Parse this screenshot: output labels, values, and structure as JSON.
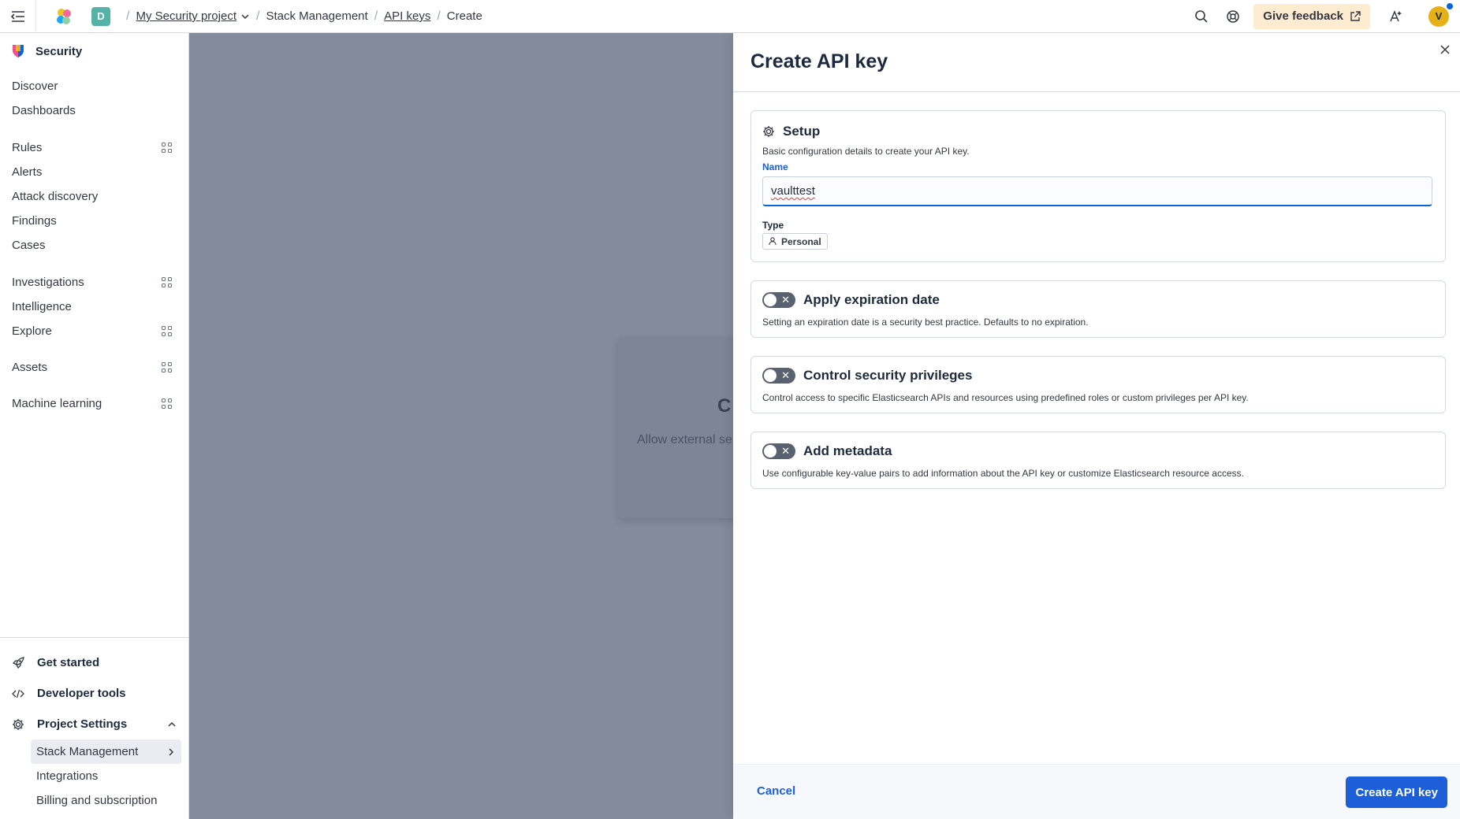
{
  "header": {
    "space_initial": "D",
    "breadcrumbs": [
      "My Security project",
      "Stack Management",
      "API keys",
      "Create"
    ],
    "feedback_label": "Give feedback",
    "avatar_initial": "V"
  },
  "sidebar": {
    "title": "Security",
    "groups": [
      [
        {
          "label": "Discover"
        },
        {
          "label": "Dashboards"
        }
      ],
      [
        {
          "label": "Rules"
        },
        {
          "label": "Alerts"
        },
        {
          "label": "Attack discovery"
        },
        {
          "label": "Findings"
        },
        {
          "label": "Cases"
        }
      ],
      [
        {
          "label": "Investigations"
        },
        {
          "label": "Intelligence"
        },
        {
          "label": "Explore"
        }
      ],
      [
        {
          "label": "Assets"
        }
      ],
      [
        {
          "label": "Machine learning"
        }
      ]
    ],
    "bottom": {
      "get_started": "Get started",
      "developer_tools": "Developer tools",
      "project_settings": "Project Settings",
      "sub_items": [
        "Stack Management",
        "Integrations",
        "Billing and subscription"
      ]
    }
  },
  "background": {
    "card_title": "C",
    "card_text": "Allow external se"
  },
  "flyout": {
    "title": "Create API key",
    "setup": {
      "title": "Setup",
      "description": "Basic configuration details to create your API key.",
      "name_label": "Name",
      "name_value": "vaulttest",
      "type_label": "Type",
      "type_value": "Personal"
    },
    "sections": [
      {
        "title": "Apply expiration date",
        "description": "Setting an expiration date is a security best practice. Defaults to no expiration.",
        "enabled": false
      },
      {
        "title": "Control security privileges",
        "description": "Control access to specific Elasticsearch APIs and resources using predefined roles or custom privileges per API key.",
        "enabled": false
      },
      {
        "title": "Add metadata",
        "description": "Use configurable key-value pairs to add information about the API key or customize Elasticsearch resource access.",
        "enabled": false
      }
    ],
    "footer": {
      "cancel_label": "Cancel",
      "submit_label": "Create API key"
    }
  },
  "colors": {
    "primary": "#1d5fd8",
    "overlay": "#838b9c",
    "feedback_bg": "#fdecd0",
    "avatar": "#e6b116",
    "space_badge": "#54b3a6"
  }
}
